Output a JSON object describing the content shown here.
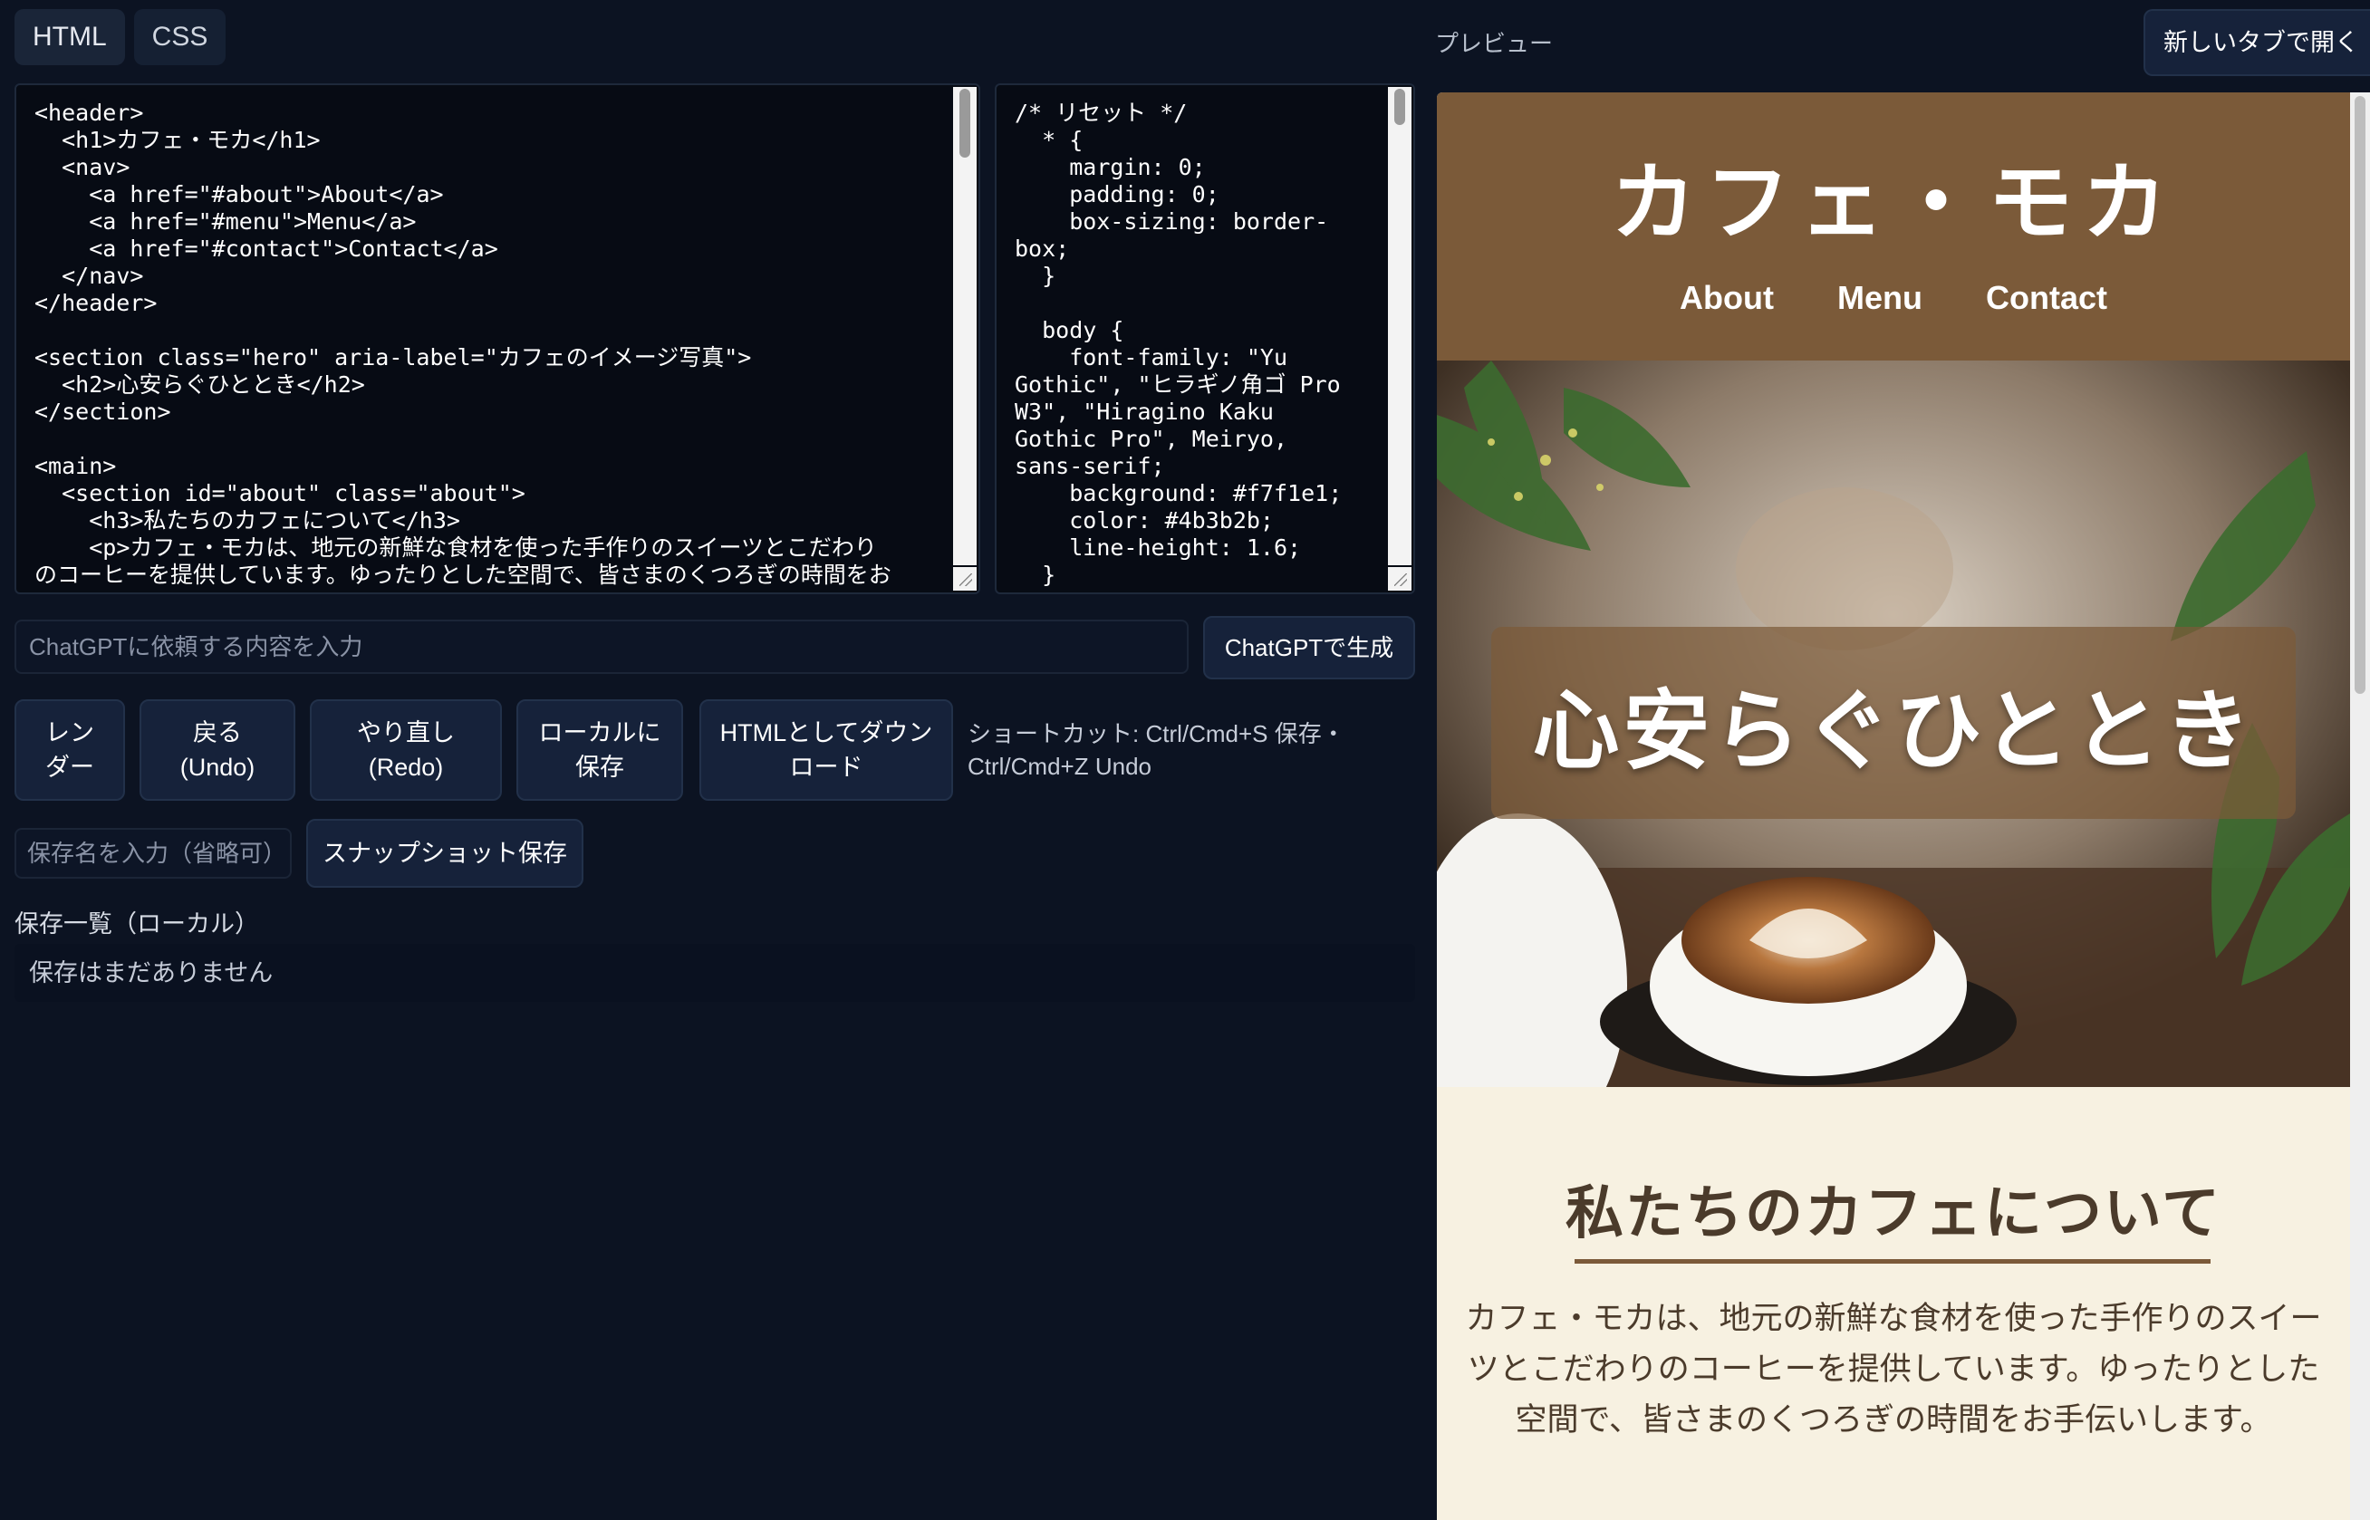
{
  "editor": {
    "tabs": [
      {
        "label": "HTML",
        "active": true
      },
      {
        "label": "CSS",
        "active": false
      }
    ],
    "html_code": "<header>\n  <h1>カフェ・モカ</h1>\n  <nav>\n    <a href=\"#about\">About</a>\n    <a href=\"#menu\">Menu</a>\n    <a href=\"#contact\">Contact</a>\n  </nav>\n</header>\n\n<section class=\"hero\" aria-label=\"カフェのイメージ写真\">\n  <h2>心安らぐひととき</h2>\n</section>\n\n<main>\n  <section id=\"about\" class=\"about\">\n    <h3>私たちのカフェについて</h3>\n    <p>カフェ・モカは、地元の新鮮な食材を使った手作りのスイーツとこだわり\nのコーヒーを提供しています。ゆったりとした空間で、皆さまのくつろぎの時間をお",
    "css_code": "/* リセット */\n  * {\n    margin: 0;\n    padding: 0;\n    box-sizing: border-\nbox;\n  }\n\n  body {\n    font-family: \"Yu\nGothic\", \"ヒラギノ角ゴ Pro\nW3\", \"Hiragino Kaku\nGothic Pro\", Meiryo,\nsans-serif;\n    background: #f7f1e1;\n    color: #4b3b2b;\n    line-height: 1.6;\n  }"
  },
  "prompt": {
    "placeholder": "ChatGPTに依頼する内容を入力",
    "generate_label": "ChatGPTで生成"
  },
  "actions": {
    "render_label": "レン\nダー",
    "undo_label": "戻る\n(Undo)",
    "redo_label": "やり直し\n(Redo)",
    "save_local_label": "ローカルに\n保存",
    "download_label": "HTMLとしてダウン\nロード",
    "shortcut_text": "ショートカット: Ctrl/Cmd+S 保存・\nCtrl/Cmd+Z Undo"
  },
  "snapshot": {
    "name_placeholder": "保存名を入力（省略可）",
    "save_label": "スナップショット保存"
  },
  "saves": {
    "heading": "保存一覧（ローカル）",
    "empty_text": "保存はまだありません"
  },
  "preview": {
    "label": "プレビュー",
    "open_new_tab_label": "新しいタブで開く",
    "site": {
      "title": "カフェ・モカ",
      "nav": [
        "About",
        "Menu",
        "Contact"
      ],
      "hero_heading": "心安らぐひととき",
      "about_heading": "私たちのカフェについて",
      "about_text": "カフェ・モカは、地元の新鮮な食材を使った手作りのスイーツとこだわりのコーヒーを提供しています。ゆったりとした空間で、皆さまのくつろぎの時間をお手伝いします。"
    }
  },
  "colors": {
    "app_bg": "#0c1322",
    "button_bg": "#16223a",
    "site_brown": "#7b5a39",
    "site_cream": "#f7f1e1",
    "site_text": "#4b3b2b"
  }
}
